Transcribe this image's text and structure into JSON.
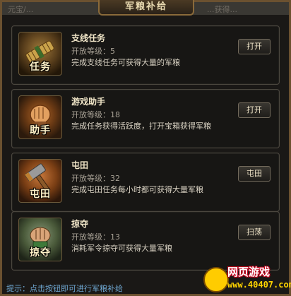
{
  "window": {
    "title": "军粮补给",
    "bg_text_left": "元宝/...",
    "bg_text_right": "...获得..."
  },
  "cards": [
    {
      "icon_name": "scroll-bundle-icon",
      "icon_label": "任务",
      "title": "支线任务",
      "level": "开放等级：5",
      "description": "完成支线任务可获得大量的军粮",
      "button": "打开"
    },
    {
      "icon_name": "fist-icon",
      "icon_label": "助手",
      "title": "游戏助手",
      "level": "开放等级：18",
      "description": "完成任务获得活跃度，打开宝箱获得军粮",
      "button": "打开"
    },
    {
      "icon_name": "hammer-icon",
      "icon_label": "屯田",
      "title": "屯田",
      "level": "开放等级：32",
      "description": "完成屯田任务每小时都可获得大量军粮",
      "button": "屯田"
    },
    {
      "icon_name": "grab-hand-icon",
      "icon_label": "掠夺",
      "title": "掠夺",
      "level": "开放等级：13",
      "description": "消耗军令掠夺可获得大量军粮",
      "button": "扫荡"
    }
  ],
  "footer": {
    "hint": "提示：点击按钮即可进行军粮补给"
  },
  "watermark": {
    "line1": "网页游戏",
    "line2": "www.40407.com"
  },
  "colors": {
    "accent_gold": "#8a6a3a",
    "hint_blue": "#6ea6d0",
    "logo_red": "#c2001c",
    "logo_yellow": "#ffd400"
  }
}
